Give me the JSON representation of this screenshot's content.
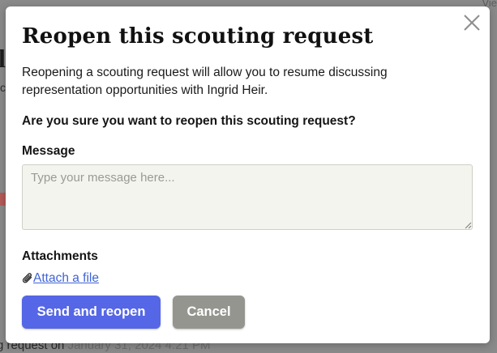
{
  "background": {
    "top_right_fragment": "Vie",
    "bottom_fragment_text": "g request on ",
    "bottom_fragment_date": "January 31, 2024 4:21 PM"
  },
  "modal": {
    "title": "Reopen this scouting request",
    "description": "Reopening a scouting request will allow you to resume discussing representation opportunities with Ingrid Heir.",
    "confirm_question": "Are you sure you want to reopen this scouting request?",
    "message_label": "Message",
    "message_placeholder": "Type your message here...",
    "message_value": "",
    "attachments_label": "Attachments",
    "attach_link": "Attach a file",
    "send_button": "Send and reopen",
    "cancel_button": "Cancel",
    "close_icon": "close-icon",
    "attach_icon": "paperclip-icon"
  },
  "colors": {
    "primary": "#5566e6",
    "secondary": "#959590",
    "link": "#3f63d8",
    "overlay": "#7f7f7f"
  }
}
